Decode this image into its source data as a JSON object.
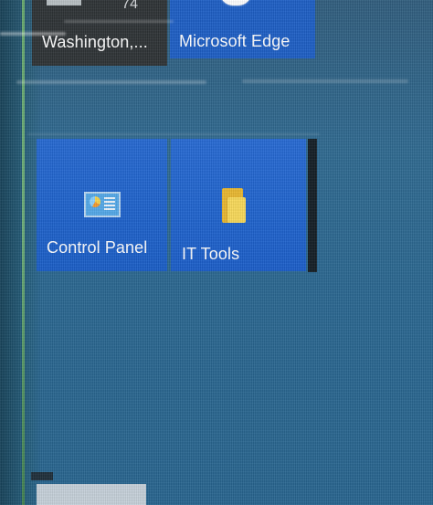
{
  "tiles": {
    "weather": {
      "label": "Washington,...",
      "temperature_partial": "74"
    },
    "edge": {
      "label": "Microsoft Edge"
    },
    "control_panel": {
      "label": "Control Panel"
    },
    "it_tools": {
      "label": "IT Tools"
    }
  },
  "icons": {
    "edge": "edge-icon",
    "control_panel": "control-panel-icon",
    "it_tools": "folder-icon"
  },
  "colors": {
    "background": "#2b6790",
    "tile_blue": "#1f63cc",
    "dark_tile": "#2e3336",
    "folder_yellow": "#f8d95a"
  }
}
